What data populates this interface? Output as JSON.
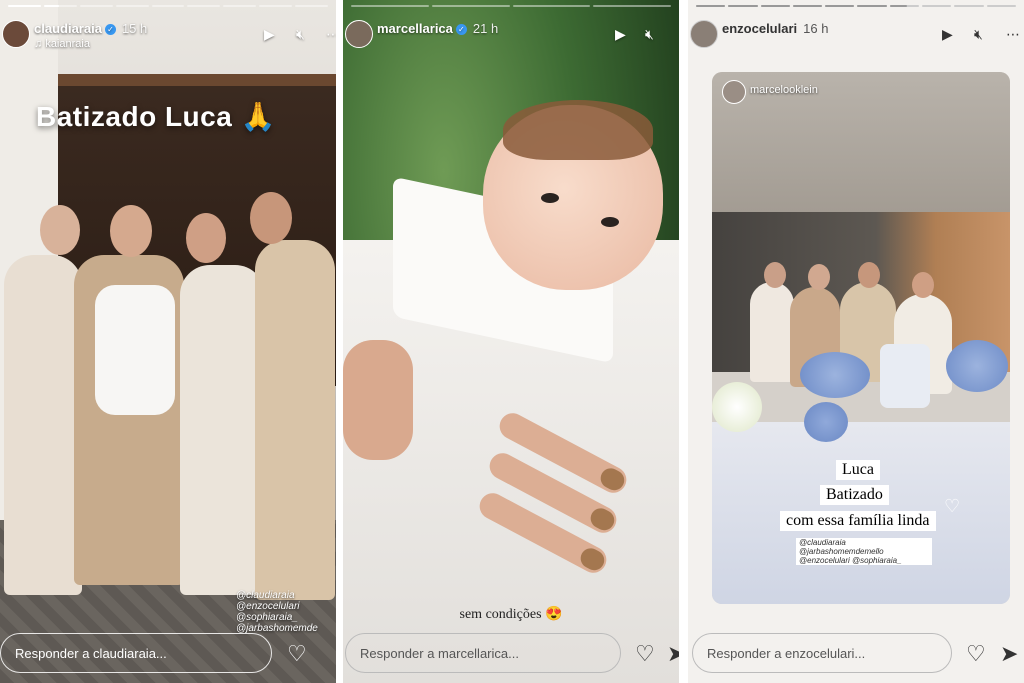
{
  "stories": [
    {
      "username": "claudiaraia",
      "time": "15 h",
      "collaborator": "kaianraia",
      "progress": [
        1,
        0.45,
        0,
        0,
        0,
        0,
        0,
        0,
        0
      ],
      "caption": "Batizado Luca",
      "caption_emoji": "🙏",
      "mentions": [
        "@claudiaraia",
        "@enzocelulari",
        "@sophiaraia_",
        "@jarbashomemde"
      ],
      "reply_placeholder": "Responder a claudiaraia..."
    },
    {
      "username": "marcellarica",
      "time": "21 h",
      "progress": [
        0,
        0,
        0,
        0
      ],
      "caption": "sem condições",
      "caption_emoji": "😍",
      "reply_placeholder": "Responder a marcellarica..."
    },
    {
      "username": "enzocelulari",
      "time": "16 h",
      "progress": [
        1,
        1,
        1,
        1,
        1,
        1,
        0.6,
        0,
        0,
        0
      ],
      "shared_user": "marcelooklein",
      "labels": [
        "Luca",
        "Batizado",
        "com essa família linda"
      ],
      "mentions": "@claudiaraia @jarbashomemdemello @enzocelulari @sophiaraia_",
      "reply_placeholder": "Responder a enzocelulari..."
    }
  ],
  "icons": {
    "play": "play-icon",
    "mute": "mute-icon",
    "more": "more-icon",
    "heart": "heart-icon",
    "send": "send-icon"
  },
  "colors": {
    "verified": "#3897f0"
  }
}
